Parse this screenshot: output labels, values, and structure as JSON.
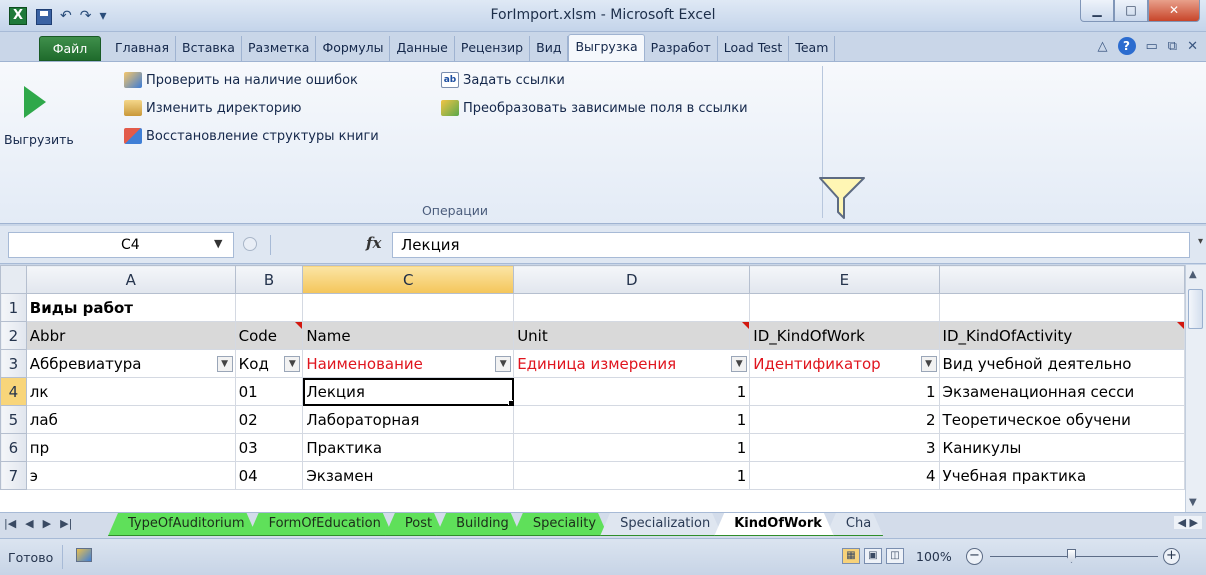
{
  "window": {
    "title": "ForImport.xlsm  -  Microsoft Excel",
    "app_icon": "X",
    "buttons": [
      "minimize",
      "maximize",
      "close"
    ]
  },
  "ribbon": {
    "file_tab": "Файл",
    "tabs": [
      "Главная",
      "Вставка",
      "Разметка",
      "Формулы",
      "Данные",
      "Рецензир",
      "Вид",
      "Выгрузка",
      "Разработ",
      "Load Test",
      "Team"
    ],
    "active_tab": "Выгрузка",
    "big_button": "Выгрузить",
    "commands": [
      {
        "label": "Проверить на наличие ошибок",
        "icon": "check-errors-icon"
      },
      {
        "label": "Изменить директорию",
        "icon": "folder-icon"
      },
      {
        "label": "Восстановление структуры книги",
        "icon": "restore-icon"
      },
      {
        "label": "Задать ссылки",
        "icon": "links-icon"
      },
      {
        "label": "Преобразовать зависимые поля в ссылки",
        "icon": "convert-icon"
      }
    ],
    "group_label": "Операции"
  },
  "formula_bar": {
    "name_box": "C4",
    "fx": "fx",
    "value": "Лекция"
  },
  "grid": {
    "columns": [
      "A",
      "B",
      "C",
      "D",
      "E",
      ""
    ],
    "rows": [
      {
        "n": "1",
        "cells": [
          "Виды работ",
          "",
          "",
          "",
          "",
          ""
        ]
      },
      {
        "n": "2",
        "cells": [
          "Abbr",
          "Code",
          "Name",
          "Unit",
          "ID_KindOfWork",
          "ID_KindOfActivity"
        ]
      },
      {
        "n": "3",
        "cells": [
          "Аббревиатура",
          "Код",
          "Наименование",
          "Единица измерения",
          "Идентификатор",
          "Вид учебной деятельно"
        ]
      },
      {
        "n": "4",
        "cells": [
          "лк",
          "01",
          "Лекция",
          "1",
          "1",
          "Экзаменационная сесси"
        ]
      },
      {
        "n": "5",
        "cells": [
          "лаб",
          "02",
          "Лабораторная",
          "1",
          "2",
          "Теоретическое обучени"
        ]
      },
      {
        "n": "6",
        "cells": [
          "пр",
          "03",
          "Практика",
          "1",
          "3",
          "Каникулы"
        ]
      },
      {
        "n": "7",
        "cells": [
          "э",
          "04",
          "Экзамен",
          "1",
          "4",
          "Учебная практика"
        ]
      }
    ]
  },
  "sheets": {
    "tabs": [
      "TypeOfAuditorium",
      "FormOfEducation",
      "Post",
      "Building",
      "Speciality",
      "Specialization",
      "KindOfWork",
      "Cha"
    ],
    "active": "KindOfWork"
  },
  "status": {
    "ready": "Готово",
    "zoom": "100%"
  }
}
